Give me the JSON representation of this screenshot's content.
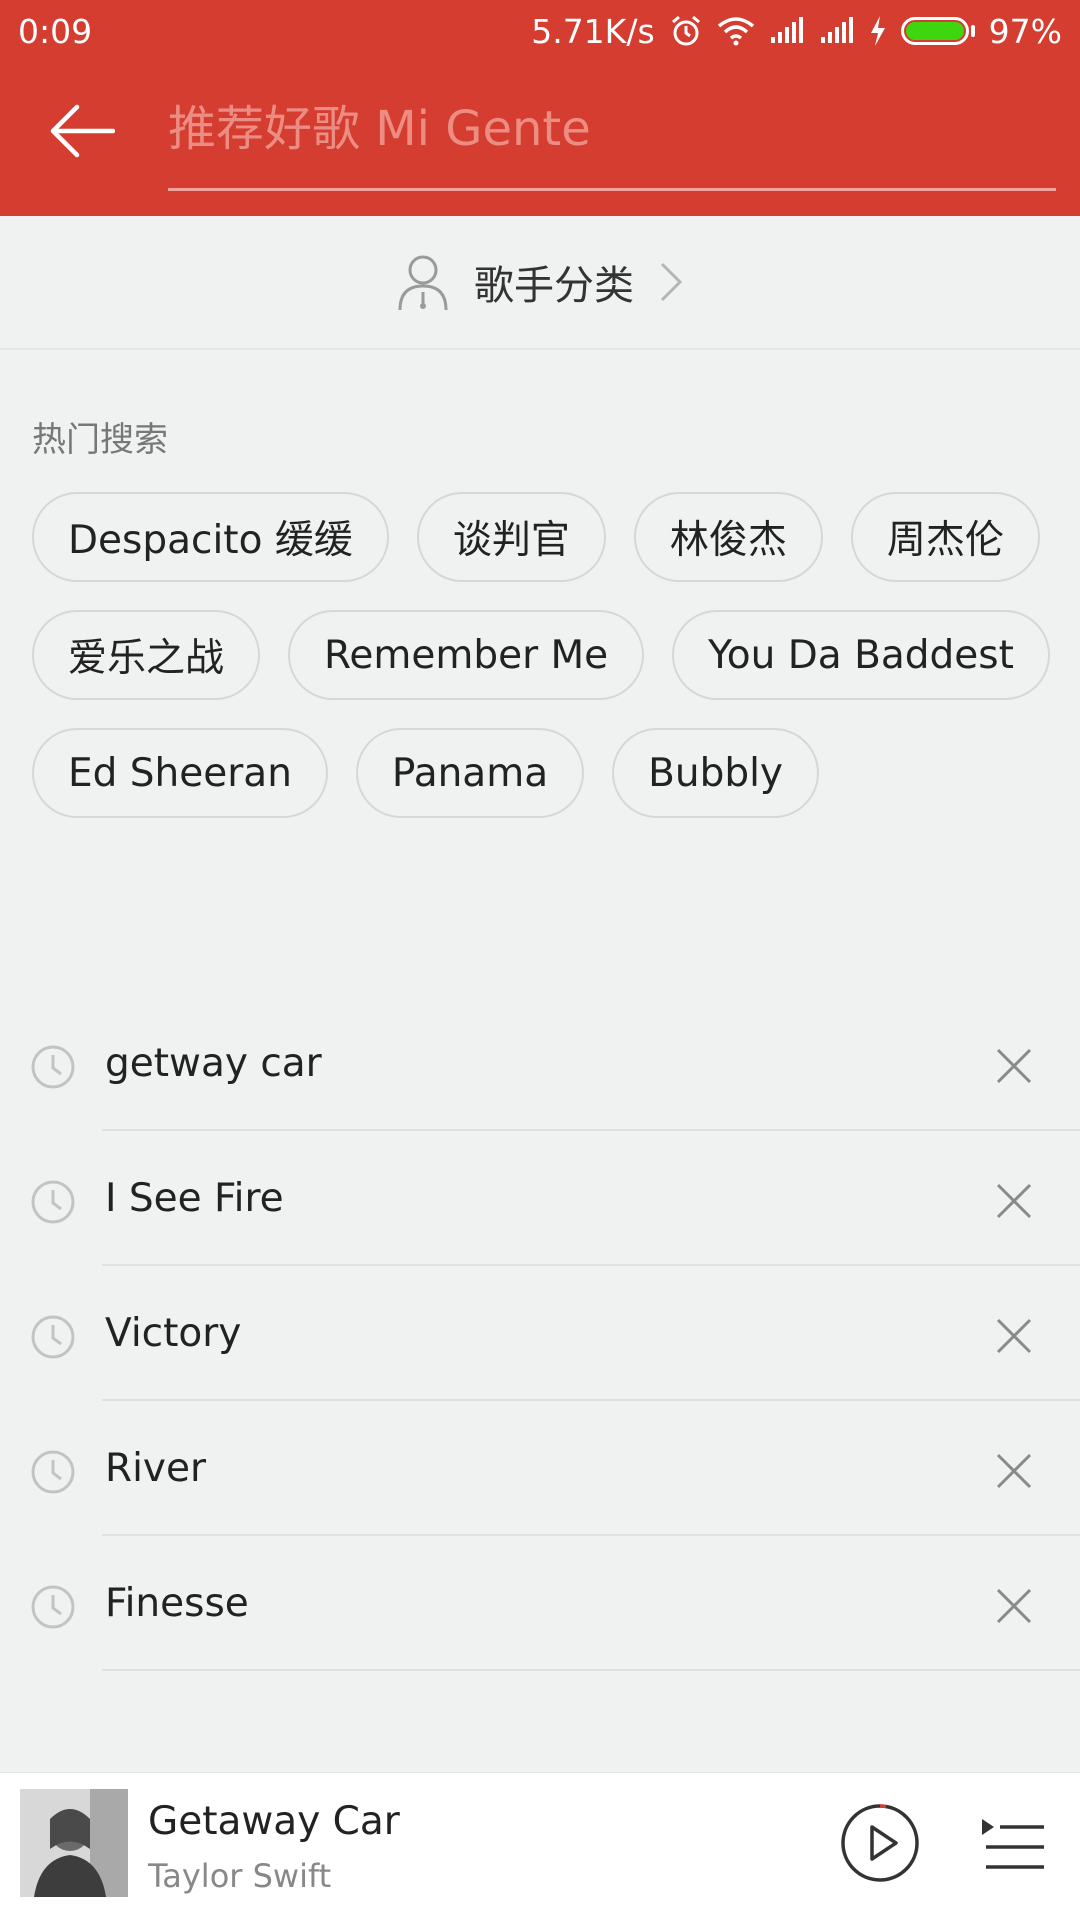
{
  "status_bar": {
    "time": "0:09",
    "net_speed": "5.71K/s",
    "battery_percent": "97%",
    "battery_color": "#3ed60f"
  },
  "search": {
    "placeholder": "推荐好歌 Mi Gente",
    "value": ""
  },
  "singer_category": {
    "label": "歌手分类",
    "icon": "person-icon"
  },
  "hot_search": {
    "title": "热门搜索",
    "tags": [
      "Despacito 缓缓",
      "谈判官",
      "林俊杰",
      "周杰伦",
      "爱乐之战",
      "Remember Me",
      "You Da Baddest",
      "Ed Sheeran",
      "Panama",
      "Bubbly"
    ]
  },
  "history": {
    "items": [
      "getway car",
      "I See Fire",
      "Victory",
      "River",
      "Finesse"
    ]
  },
  "player": {
    "song_title": "Getaway Car",
    "artist": "Taylor Swift"
  },
  "colors": {
    "accent": "#d43d30",
    "background": "#f0f2f2"
  }
}
